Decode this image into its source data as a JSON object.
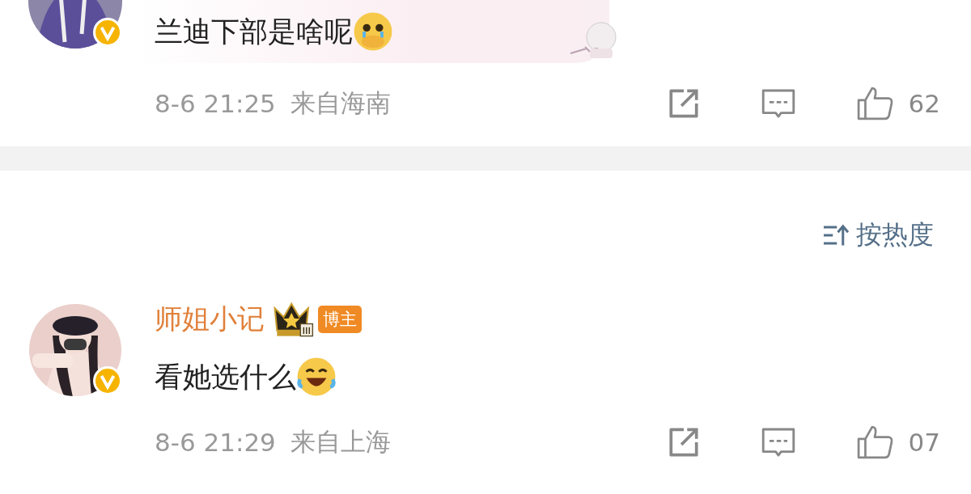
{
  "comments": [
    {
      "text": "兰迪下部是啥呢",
      "verified": true,
      "time": "8-6 21:25",
      "location": "来自海南",
      "likes": "62",
      "bubble": true
    },
    {
      "author": "师姐小记",
      "author_badge": "博主",
      "text": "看她选什么",
      "verified": true,
      "time": "8-6 21:29",
      "location": "来自上海",
      "likes": "07",
      "bubble": false
    }
  ],
  "sort_button": "按热度"
}
